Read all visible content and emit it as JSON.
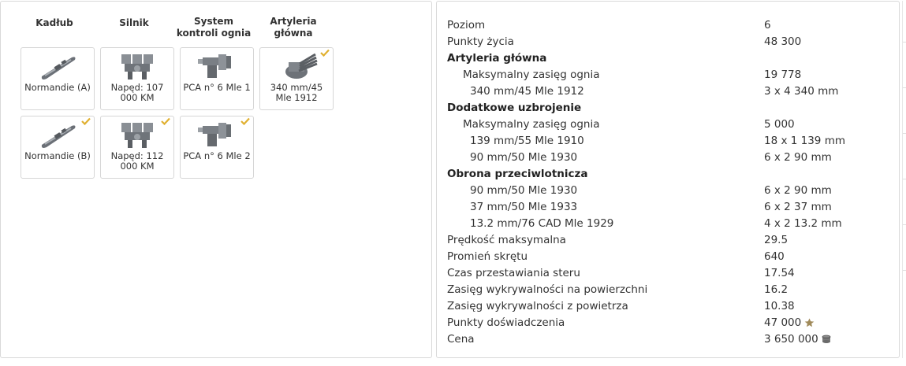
{
  "modules": {
    "headers": [
      "Kadłub",
      "Silnik",
      "System kontroli ognia",
      "Artyleria główna"
    ],
    "row1": [
      {
        "label": "Normandie (A)",
        "icon": "hull-icon",
        "checked": false
      },
      {
        "label": "Napęd: 107 000 KM",
        "icon": "engine-icon",
        "checked": false
      },
      {
        "label": "PCA n° 6 Mle 1",
        "icon": "fire-control-icon",
        "checked": false
      },
      {
        "label": "340 mm/45 Mle 1912",
        "icon": "main-gun-icon",
        "checked": true
      }
    ],
    "row2": [
      {
        "label": "Normandie (B)",
        "icon": "hull-icon",
        "checked": true
      },
      {
        "label": "Napęd: 112 000 KM",
        "icon": "engine-icon",
        "checked": true
      },
      {
        "label": "PCA n° 6 Mle 2",
        "icon": "fire-control-icon",
        "checked": true
      }
    ]
  },
  "stats": [
    {
      "label": "Poziom",
      "value": "6",
      "style": "normal"
    },
    {
      "label": "Punkty życia",
      "value": "48 300",
      "style": "normal"
    },
    {
      "label": "Artyleria główna",
      "value": "",
      "style": "section"
    },
    {
      "label": "Maksymalny zasięg ognia",
      "value": "19 778",
      "style": "indent1"
    },
    {
      "label": "340 mm/45 Mle 1912",
      "value": "3 x 4 340 mm",
      "style": "indent2"
    },
    {
      "label": "Dodatkowe uzbrojenie",
      "value": "",
      "style": "section"
    },
    {
      "label": "Maksymalny zasięg ognia",
      "value": "5 000",
      "style": "indent1"
    },
    {
      "label": "139 mm/55 Mle 1910",
      "value": "18 x 1 139 mm",
      "style": "indent2"
    },
    {
      "label": "90 mm/50 Mle 1930",
      "value": "6 x 2 90 mm",
      "style": "indent2"
    },
    {
      "label": "Obrona przeciwlotnicza",
      "value": "",
      "style": "section"
    },
    {
      "label": "90 mm/50 Mle 1930",
      "value": "6 x 2 90 mm",
      "style": "indent2"
    },
    {
      "label": "37 mm/50 Mle 1933",
      "value": "6 x 2 37 mm",
      "style": "indent2"
    },
    {
      "label": "13.2 mm/76 CAD Mle 1929",
      "value": "4 x 2 13.2 mm",
      "style": "indent2"
    },
    {
      "label": "Prędkość maksymalna",
      "value": "29.5",
      "style": "normal"
    },
    {
      "label": "Promień skrętu",
      "value": "640",
      "style": "normal"
    },
    {
      "label": "Czas przestawiania steru",
      "value": "17.54",
      "style": "normal"
    },
    {
      "label": "Zasięg wykrywalności na powierzchni",
      "value": "16.2",
      "style": "normal"
    },
    {
      "label": "Zasięg wykrywalności z powietrza",
      "value": "10.38",
      "style": "normal"
    },
    {
      "label": "Punkty doświadczenia",
      "value": "47 000",
      "style": "normal",
      "icon": "experience-star-icon"
    },
    {
      "label": "Cena",
      "value": "3 650 000",
      "style": "normal",
      "icon": "credits-icon"
    }
  ],
  "colors": {
    "check": "#e0b030",
    "border": "#d6d6d6",
    "icon_gray": "#7a7f85"
  }
}
